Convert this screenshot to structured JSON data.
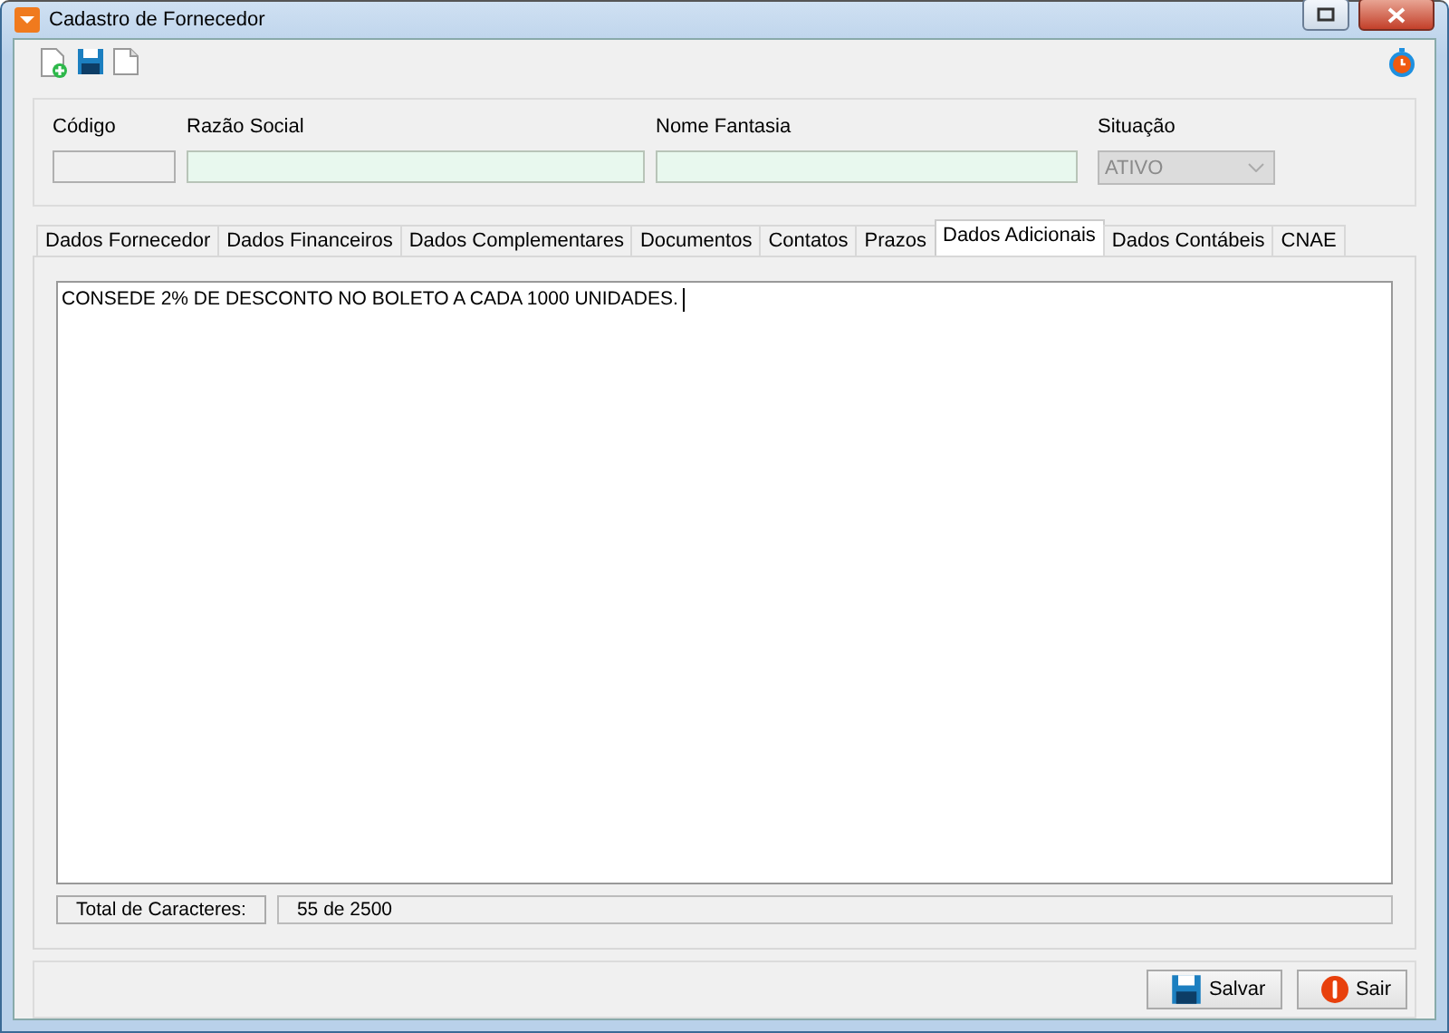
{
  "window": {
    "title": "Cadastro de Fornecedor"
  },
  "header_fields": [
    {
      "label": "Código",
      "kind": "text",
      "disabled": true
    },
    {
      "label": "Razão Social",
      "kind": "text",
      "disabled": false
    },
    {
      "label": "Nome Fantasia",
      "kind": "text",
      "disabled": false
    },
    {
      "label": "Situação",
      "kind": "select",
      "value": "ATIVO",
      "disabled": true
    }
  ],
  "tabs": [
    {
      "label": "Dados Fornecedor",
      "selected": false
    },
    {
      "label": "Dados Financeiros",
      "selected": false
    },
    {
      "label": "Dados Complementares",
      "selected": false
    },
    {
      "label": "Documentos",
      "selected": false
    },
    {
      "label": "Contatos",
      "selected": false
    },
    {
      "label": "Prazos",
      "selected": false
    },
    {
      "label": "Dados Adicionais",
      "selected": true
    },
    {
      "label": "Dados Contábeis",
      "selected": false
    },
    {
      "label": "CNAE",
      "selected": false
    }
  ],
  "notes": {
    "value": "CONSEDE 2% DE DESCONTO NO BOLETO A CADA 1000 UNIDADES. ",
    "focused": true
  },
  "counter": {
    "label": "Total de Caracteres:",
    "value": "55 de 2500"
  },
  "buttons": [
    {
      "label": "Salvar",
      "kind": "save"
    },
    {
      "label": "Sair",
      "kind": "exit"
    }
  ]
}
